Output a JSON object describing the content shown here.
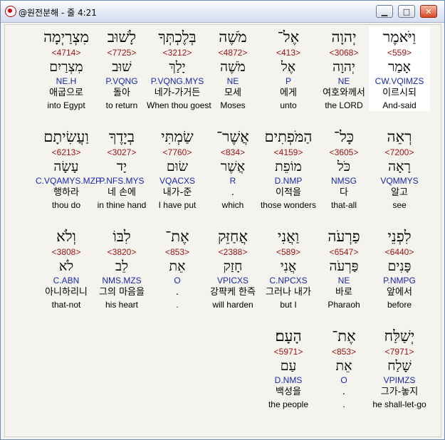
{
  "window": {
    "title": "@원전분해 - 줄 4:21",
    "buttons": {
      "minimize": "▁",
      "maximize": "□",
      "close": "✕"
    }
  },
  "rows": [
    {
      "words": [
        {
          "heb": "וַיֹּאמֶר",
          "num": "<559>",
          "lex": "אָמַר",
          "parse": "CW.VQIMZS",
          "kor": "이르시되",
          "eng": "And-said",
          "selected": true
        },
        {
          "heb": "יְהוָה",
          "num": "<3068>",
          "lex": "יְהוָה",
          "parse": "NE",
          "kor": "여호와께서",
          "eng": "the LORD"
        },
        {
          "heb": "אֶל־",
          "num": "<413>",
          "lex": "אֶל",
          "parse": "P",
          "kor": "에게",
          "eng": "unto"
        },
        {
          "heb": "מֹשֶׁה",
          "num": "<4872>",
          "lex": "מֹשֶׁה",
          "parse": "NE",
          "kor": "모세",
          "eng": "Moses"
        },
        {
          "heb": "בְּלֶכְתְּךָ",
          "num": "<3212>",
          "lex": "יָלַךְ",
          "parse": "P.VQNG.MYS",
          "kor": "네가-가거든",
          "eng": "When thou goest"
        },
        {
          "heb": "לָשׁוּב",
          "num": "<7725>",
          "lex": "שׁוּב",
          "parse": "P.VQNG",
          "kor": "돌아",
          "eng": "to return"
        },
        {
          "heb": "מִצְרַיְמָה",
          "num": "<4714>",
          "lex": "מִצְרַיִם",
          "parse": "NE.H",
          "kor": "애굽으로",
          "eng": "into Egypt"
        }
      ]
    },
    {
      "words": [
        {
          "heb": "רְאֵה",
          "num": "<7200>",
          "lex": "רָאָה",
          "parse": "VQMMYS",
          "kor": "알고",
          "eng": "see"
        },
        {
          "heb": "כָּל־",
          "num": "<3605>",
          "lex": "כֹּל",
          "parse": "NMSG",
          "kor": "다",
          "eng": "that-all"
        },
        {
          "heb": "הַמֹּפְתִים",
          "num": "<4159>",
          "lex": "מוֹפֵת",
          "parse": "D.NMP",
          "kor": "이적을",
          "eng": "those wonders"
        },
        {
          "heb": "אֲשֶׁר־",
          "num": "<834>",
          "lex": "אֲשֶׁר",
          "parse": "R",
          "kor": ".",
          "eng": "which"
        },
        {
          "heb": "שַׂמְתִּי",
          "num": "<7760>",
          "lex": "שׂוּם",
          "parse": "VQACXS",
          "kor": "내가-준",
          "eng": "I have put"
        },
        {
          "heb": "בְיָדֶךָ",
          "num": "<3027>",
          "lex": "יָד",
          "parse": "P.NFS.MYS",
          "kor": "네 손에",
          "eng": "in thine hand"
        },
        {
          "heb": "וַעֲשִׂיתָם",
          "num": "<6213>",
          "lex": "עָשָׂה",
          "parse": "C.VQAMYS.MZP",
          "kor": "행하라",
          "eng": "thou do"
        }
      ]
    },
    {
      "words": [
        {
          "heb": "לִפְנֵי",
          "num": "<6440>",
          "lex": "פָּנִים",
          "parse": "P.NMPG",
          "kor": "앞에서",
          "eng": "before"
        },
        {
          "heb": "פַרְעֹה",
          "num": "<6547>",
          "lex": "פַּרְעֹה",
          "parse": "NE",
          "kor": "바로",
          "eng": "Pharaoh"
        },
        {
          "heb": "וַאֲנִי",
          "num": "<589>",
          "lex": "אֲנִי",
          "parse": "C.NPCXS",
          "kor": "그러나 내가",
          "eng": "but I"
        },
        {
          "heb": "אֲחַזֵּק",
          "num": "<2388>",
          "lex": "חָזַק",
          "parse": "VPICXS",
          "kor": "강퍅케 한즉",
          "eng": "will harden"
        },
        {
          "heb": "אֶת־",
          "num": "<853>",
          "lex": "אֵת",
          "parse": "O",
          "kor": ".",
          "eng": "."
        },
        {
          "heb": "לִבּוֹ",
          "num": "<3820>",
          "lex": "לֵב",
          "parse": "NMS.MZS",
          "kor": "그의 마음을",
          "eng": "his heart"
        },
        {
          "heb": "וְלֹא",
          "num": "<3808>",
          "lex": "לֹא",
          "parse": "C.ABN",
          "kor": "아니하리니",
          "eng": "that-not"
        }
      ]
    },
    {
      "words": [
        {
          "heb": "יְשַׁלַּח",
          "num": "<7971>",
          "lex": "שָׁלַח",
          "parse": "VPIMZS",
          "kor": "그가-놓지",
          "eng": "he shall-let-go"
        },
        {
          "heb": "אֶת־",
          "num": "<853>",
          "lex": "אֵת",
          "parse": "O",
          "kor": ".",
          "eng": "."
        },
        {
          "heb": "הָעָם׃",
          "num": "<5971>",
          "lex": "עַם",
          "parse": "D.NMS",
          "kor": "백성을",
          "eng": "the people"
        }
      ]
    }
  ]
}
